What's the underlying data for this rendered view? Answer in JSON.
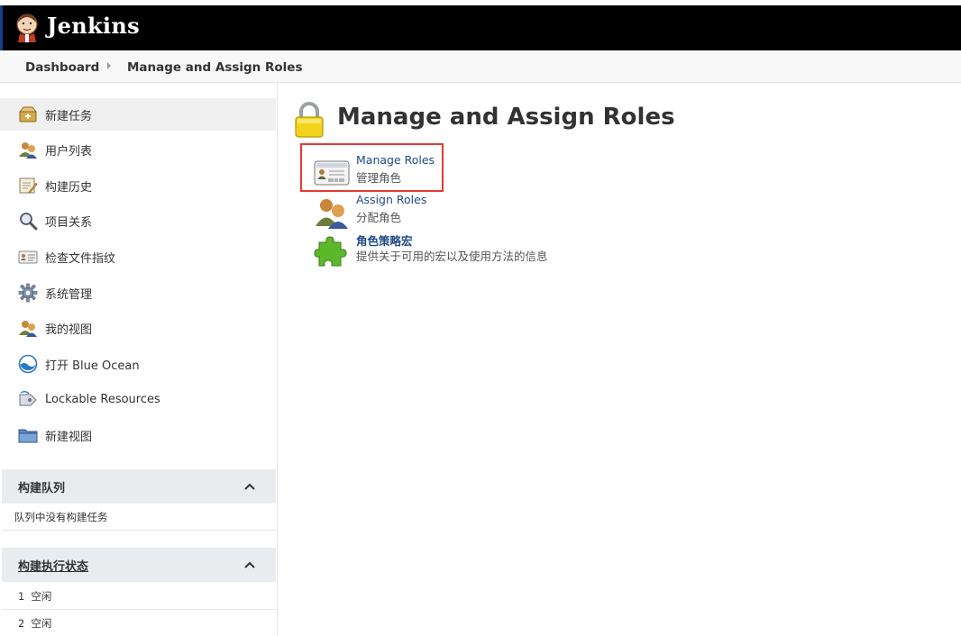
{
  "header": {
    "brand": "Jenkins"
  },
  "breadcrumb": {
    "items": [
      "Dashboard",
      "Manage and Assign Roles"
    ]
  },
  "sidebar": {
    "items": [
      {
        "label": "新建任务",
        "icon": "new-item-icon"
      },
      {
        "label": "用户列表",
        "icon": "users-icon"
      },
      {
        "label": "构建历史",
        "icon": "build-history-icon"
      },
      {
        "label": "项目关系",
        "icon": "search-icon"
      },
      {
        "label": "检查文件指纹",
        "icon": "fingerprint-icon"
      },
      {
        "label": "系统管理",
        "icon": "gear-icon"
      },
      {
        "label": "我的视图",
        "icon": "my-views-icon"
      },
      {
        "label": "打开 Blue Ocean",
        "icon": "blue-ocean-icon"
      },
      {
        "label": "Lockable Resources",
        "icon": "lockable-resources-icon"
      },
      {
        "label": "新建视图",
        "icon": "folder-icon"
      }
    ]
  },
  "build_queue": {
    "title": "构建队列",
    "empty_text": "队列中没有构建任务"
  },
  "executors": {
    "title": "构建执行状态",
    "rows": [
      {
        "num": "1",
        "state": "空闲"
      },
      {
        "num": "2",
        "state": "空闲"
      }
    ]
  },
  "main": {
    "title": "Manage and Assign Roles",
    "entries": [
      {
        "link": "Manage Roles",
        "desc": "管理角色",
        "icon": "id-card-icon"
      },
      {
        "link": "Assign Roles",
        "desc": "分配角色",
        "icon": "assign-users-icon"
      },
      {
        "link": "角色策略宏",
        "desc": "提供关于可用的宏以及使用方法的信息",
        "icon": "puzzle-icon"
      }
    ]
  },
  "colors": {
    "header_bg": "#000000",
    "link": "#204a87",
    "highlight": "#e53935"
  }
}
